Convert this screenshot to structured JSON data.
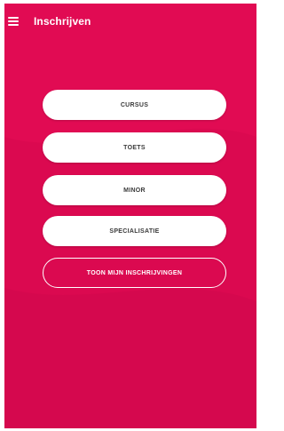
{
  "app_bar": {
    "title": "Inschrijven",
    "menu_icon": "hamburger-menu-icon"
  },
  "actions": {
    "cursus": "CURSUS",
    "toets": "TOETS",
    "minor": "MINOR",
    "specialisatie": "SPECIALISATIE",
    "my_enrollments": "TOON MIJN INSCHRIJVINGEN"
  },
  "colors": {
    "background": "#e10b53",
    "button_fill": "#ffffff",
    "button_text": "#3a3a3a",
    "outline": "#ffffff"
  }
}
